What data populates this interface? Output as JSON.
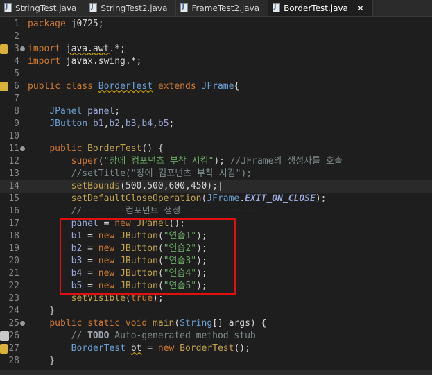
{
  "tabs": [
    {
      "label": "StringTest.java",
      "active": false,
      "closable": false
    },
    {
      "label": "StringTest2.java",
      "active": false,
      "closable": false
    },
    {
      "label": "FrameTest2.java",
      "active": false,
      "closable": false
    },
    {
      "label": "BorderTest.java",
      "active": true,
      "closable": true
    }
  ],
  "close_glyph": "✕",
  "lines": [
    {
      "n": "1",
      "code": "package j0725;"
    },
    {
      "n": "2",
      "code": ""
    },
    {
      "n": "3",
      "code": "import java.awt.*;"
    },
    {
      "n": "4",
      "code": "import javax.swing.*;"
    },
    {
      "n": "5",
      "code": ""
    },
    {
      "n": "6",
      "code": "public class BorderTest extends JFrame{"
    },
    {
      "n": "7",
      "code": ""
    },
    {
      "n": "8",
      "code": "    JPanel panel;"
    },
    {
      "n": "9",
      "code": "    JButton b1,b2,b3,b4,b5;"
    },
    {
      "n": "10",
      "code": ""
    },
    {
      "n": "11",
      "code": "    public BorderTest() {"
    },
    {
      "n": "12",
      "code": "        super(\"창에 컴포넌츠 부착 시킴\"); //JFrame의 생성자를 호출"
    },
    {
      "n": "13",
      "code": "        //setTitle(\"창에 컴포넌츠 부착 시킴\");"
    },
    {
      "n": "14",
      "code": "        setBounds(500,500,600,450);"
    },
    {
      "n": "15",
      "code": "        setDefaultCloseOperation(JFrame.EXIT_ON_CLOSE);"
    },
    {
      "n": "16",
      "code": "        //--------컴포넌트 생성 -------------"
    },
    {
      "n": "17",
      "code": "        panel = new JPanel();"
    },
    {
      "n": "18",
      "code": "        b1 = new JButton(\"연습1\");"
    },
    {
      "n": "19",
      "code": "        b2 = new JButton(\"연습2\");"
    },
    {
      "n": "20",
      "code": "        b3 = new JButton(\"연습3\");"
    },
    {
      "n": "21",
      "code": "        b4 = new JButton(\"연습4\");"
    },
    {
      "n": "22",
      "code": "        b5 = new JButton(\"연습5\");"
    },
    {
      "n": "23",
      "code": "        setVisible(true);"
    },
    {
      "n": "24",
      "code": "    }"
    },
    {
      "n": "25",
      "code": "    public static void main(String[] args) {"
    },
    {
      "n": "26",
      "code": "        // TODO Auto-generated method stub"
    },
    {
      "n": "27",
      "code": "        BorderTest bt = new BorderTest();"
    },
    {
      "n": "28",
      "code": "    }"
    }
  ],
  "colors": {
    "background": "#1e1e1e",
    "keyword": "#cc7832",
    "type": "#6a9fd4",
    "string": "#6aaa64",
    "comment": "#7f8c8d",
    "highlight_box": "#e01010"
  },
  "highlight_box_lines": [
    "17",
    "22"
  ]
}
